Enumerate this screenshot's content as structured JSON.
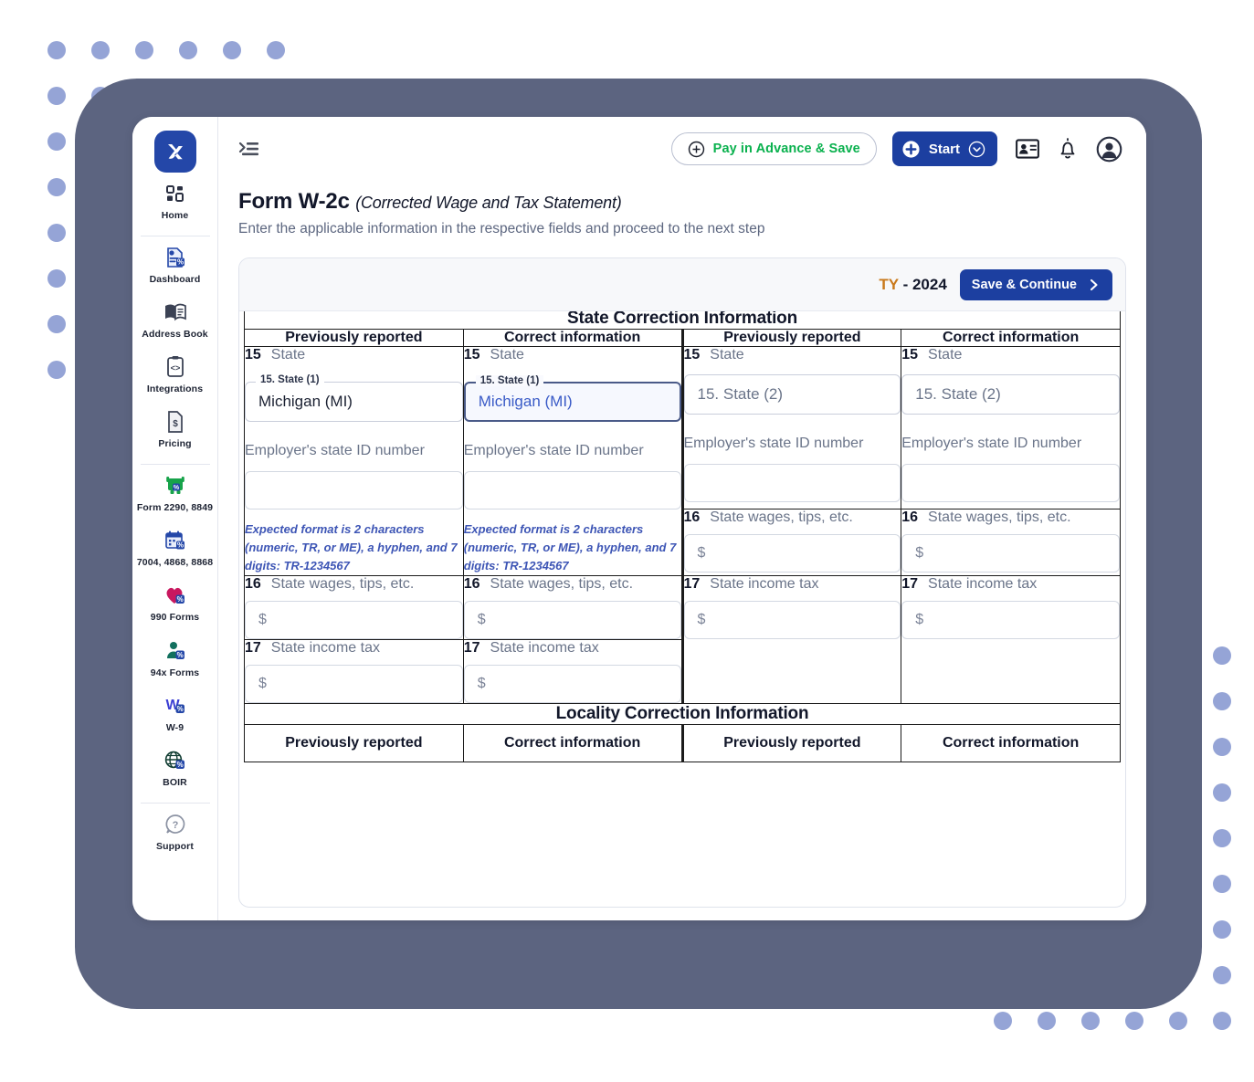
{
  "app": {
    "logo_icon": "x-logo-icon",
    "collapse_icon": "collapse-menu-icon"
  },
  "topbar": {
    "pay_advance_label": "Pay in Advance & Save",
    "pay_advance_icon": "plus-circle-icon",
    "start_label": "Start",
    "start_icon": "plus-circle-filled-icon",
    "start_caret_icon": "chevron-down-circle-icon",
    "contact_card_icon": "contact-card-icon",
    "bell_icon": "notification-bell-icon",
    "account_icon": "user-account-icon"
  },
  "sidebar": {
    "items": [
      {
        "label": "Home",
        "icon": "grid-dashboard-icon"
      },
      {
        "label": "Dashboard",
        "icon": "document-percent-icon"
      },
      {
        "label": "Address Book",
        "icon": "open-book-icon"
      },
      {
        "label": "Integrations",
        "icon": "code-brackets-icon"
      },
      {
        "label": "Pricing",
        "icon": "dollar-document-icon"
      },
      {
        "label": "Form 2290, 8849",
        "icon": "truck-icon"
      },
      {
        "label": "7004, 4868, 8868",
        "icon": "calendar-percent-icon"
      },
      {
        "label": "990 Forms",
        "icon": "heart-percent-icon"
      },
      {
        "label": "94x Forms",
        "icon": "person-percent-icon"
      },
      {
        "label": "W-9",
        "icon": "w9-letter-icon"
      },
      {
        "label": "BOIR",
        "icon": "globe-percent-icon"
      },
      {
        "label": "Support",
        "icon": "question-bubble-icon"
      }
    ]
  },
  "page": {
    "title": "Form W-2c",
    "title_paren": "(Corrected Wage and Tax Statement)",
    "subtitle": "Enter the applicable information in the respective fields and proceed to the next step"
  },
  "card": {
    "ty_prefix": "TY",
    "ty_value": "- 2024",
    "save_continue_label": "Save & Continue",
    "save_continue_icon": "chevron-right-icon"
  },
  "form": {
    "section_state": "State Correction Information",
    "section_locality": "Locality Correction Information",
    "col_headers": [
      "Previously reported",
      "Correct information",
      "Previously reported",
      "Correct information"
    ],
    "locality_col_headers": [
      "Previously reported",
      "Correct information",
      "Previously reported",
      "Correct information"
    ],
    "state_row": {
      "num": "15",
      "label": "State",
      "col1": {
        "legend": "15. State (1)",
        "value": "Michigan (MI)",
        "focused": false,
        "has_legend": true
      },
      "col2": {
        "legend": "15. State (1)",
        "value": "Michigan (MI)",
        "focused": true,
        "has_legend": true
      },
      "col3": {
        "legend": "",
        "value": "15. State (2)",
        "focused": false,
        "has_legend": false,
        "placeholder": true
      },
      "col4": {
        "legend": "",
        "value": "15. State (2)",
        "focused": false,
        "has_legend": false,
        "placeholder": true
      }
    },
    "employer_id": {
      "label": "Employer's state ID number",
      "hint": "Expected format is 2 characters (numeric, TR, or ME), a hyphen, and 7 digits: TR-1234567"
    },
    "wages_row": {
      "num": "16",
      "label": "State wages, tips, etc.",
      "placeholder": "$"
    },
    "income_tax_row": {
      "num": "17",
      "label": "State income tax",
      "placeholder": "$"
    }
  },
  "colors": {
    "brand_blue": "#1c3fa0",
    "accent_green": "#0ab14e",
    "frame_slate": "#5c6480",
    "dot_periwinkle": "#95a4d6",
    "hint_blue": "#3d55b5",
    "ty_orange": "#c9791b"
  }
}
